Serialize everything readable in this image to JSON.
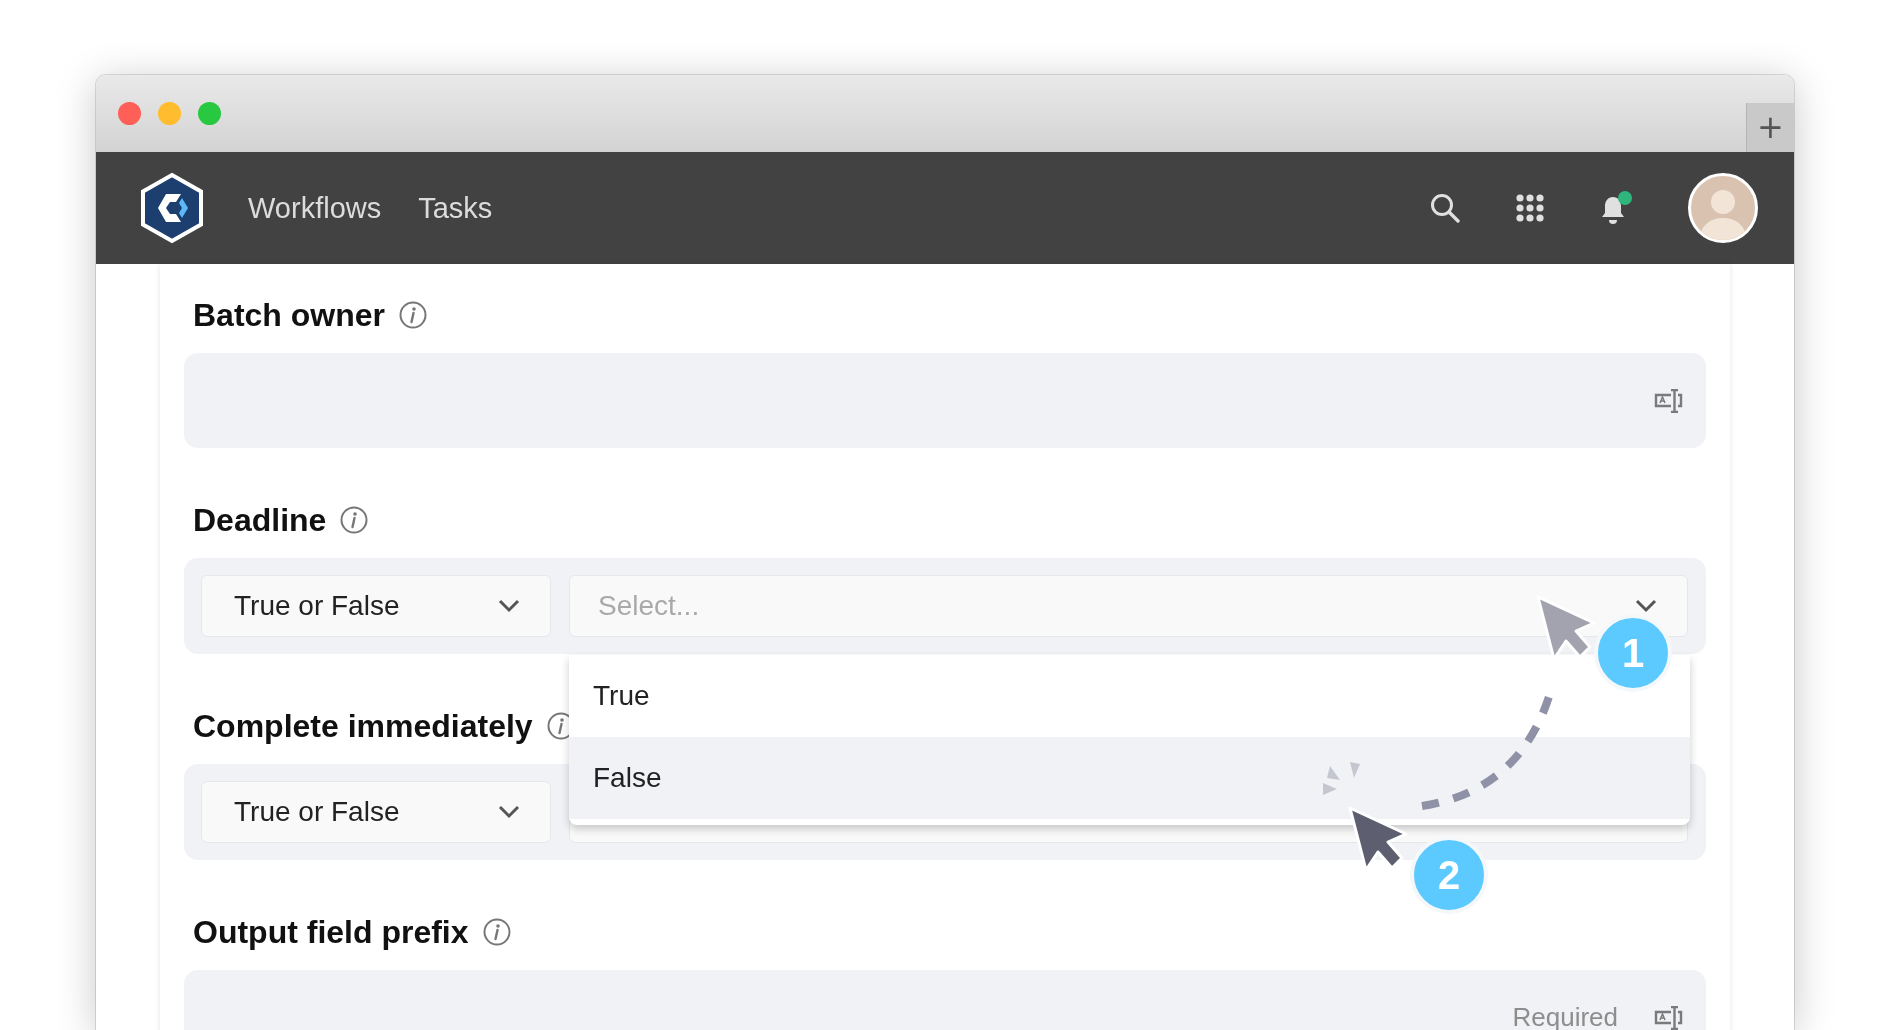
{
  "window": {
    "new_tab_button": "+"
  },
  "nav": {
    "items": [
      {
        "label": "Workflows"
      },
      {
        "label": "Tasks"
      }
    ],
    "notification_badge": true
  },
  "fields": [
    {
      "kind": "text",
      "label": "Batch owner"
    },
    {
      "kind": "condition",
      "label": "Deadline",
      "type_select": "True or False",
      "value_select": {
        "placeholder": "Select...",
        "options": [
          {
            "label": "True",
            "selected": false
          },
          {
            "label": "False",
            "selected": true
          }
        ]
      }
    },
    {
      "kind": "condition",
      "label": "Complete immediately",
      "type_select": "True or False"
    },
    {
      "kind": "text",
      "label": "Output field prefix",
      "placeholder": "Required"
    }
  ],
  "annotations": [
    {
      "label": "1"
    },
    {
      "label": "2"
    }
  ]
}
